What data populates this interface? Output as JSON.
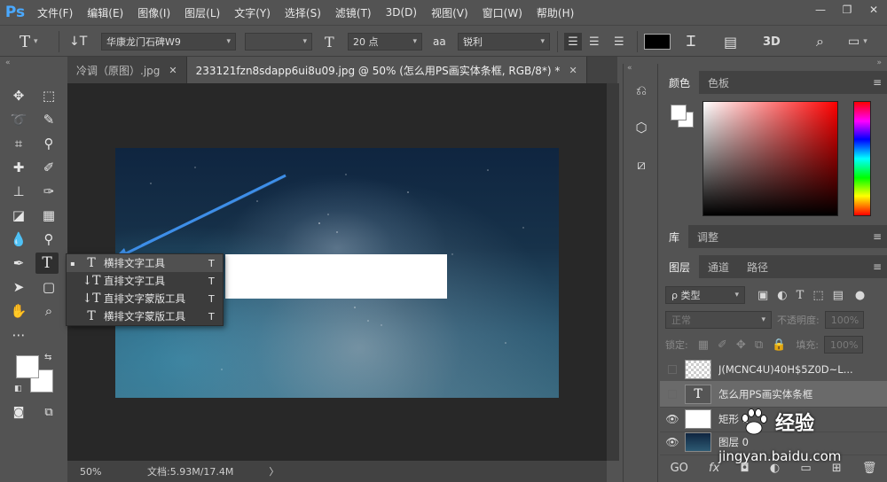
{
  "app": {
    "logo": "Ps"
  },
  "menu": [
    "文件(F)",
    "编辑(E)",
    "图像(I)",
    "图层(L)",
    "文字(Y)",
    "选择(S)",
    "滤镜(T)",
    "3D(D)",
    "视图(V)",
    "窗口(W)",
    "帮助(H)"
  ],
  "window_controls": {
    "minimize": "—",
    "restore": "❐",
    "close": "✕"
  },
  "options": {
    "tool_glyph": "T",
    "orient_glyph": "↓T",
    "font_family": "华康龙门石碑W9",
    "font_style": "",
    "size_glyph": "T",
    "font_size": "20 点",
    "aa_glyph": "aa",
    "antialias": "锐利",
    "text_color": "#000000",
    "three_d": "3D"
  },
  "tabs": [
    {
      "label": "冷调（原图）.jpg",
      "close": "✕"
    },
    {
      "label": "233121fzn8sdapp6ui8u09.jpg @ 50% (怎么用PS画实体条框, RGB/8*) *",
      "close": "✕"
    }
  ],
  "flyout": {
    "items": [
      {
        "bullet": "▪",
        "icon": "T",
        "label": "横排文字工具",
        "key": "T"
      },
      {
        "bullet": "",
        "icon": "↓T",
        "label": "直排文字工具",
        "key": "T"
      },
      {
        "bullet": "",
        "icon": "↓T",
        "label": "直排文字蒙版工具",
        "key": "T"
      },
      {
        "bullet": "",
        "icon": "T",
        "label": "横排文字蒙版工具",
        "key": "T"
      }
    ]
  },
  "status": {
    "zoom": "50%",
    "doc": "文档:5.93M/17.4M",
    "arrow": "〉"
  },
  "panels": {
    "color_tabs": [
      "颜色",
      "色板"
    ],
    "lib_tabs": [
      "库",
      "调整"
    ],
    "layer_tabs": [
      "图层",
      "通道",
      "路径"
    ],
    "filter_kind": "ρ 类型",
    "blend_mode": "正常",
    "opacity_label": "不透明度:",
    "opacity_value": "100%",
    "lock_label": "锁定:",
    "fill_label": "填充:",
    "fill_value": "100%",
    "menu_glyph": "≡"
  },
  "layers": [
    {
      "name": "J(MCNC4U)40H$5Z0D~L...",
      "type": "smart",
      "visible": false
    },
    {
      "name": "怎么用PS画实体条框",
      "type": "text",
      "visible": false,
      "selected": true
    },
    {
      "name": "矩形 1",
      "type": "shape",
      "visible": true
    },
    {
      "name": "图层 0",
      "type": "image",
      "visible": true
    }
  ],
  "layer_bottom_icons": [
    "GO",
    "fx",
    "◘",
    "◐",
    "▭",
    "⊞",
    "🗑"
  ],
  "watermark": {
    "brand": "经验",
    "url": "jingyan.baidu.com"
  }
}
